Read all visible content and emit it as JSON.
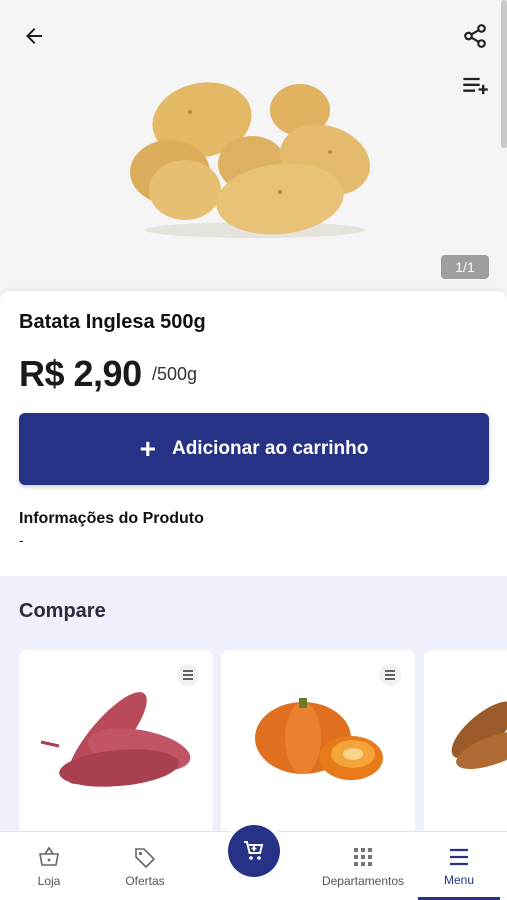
{
  "header": {
    "back_icon": "arrow-left-icon",
    "share_icon": "share-icon",
    "add_to_list_icon": "playlist-add-icon"
  },
  "gallery": {
    "counter": "1/1"
  },
  "product": {
    "name": "Batata Inglesa 500g",
    "price": "R$ 2,90",
    "unit": "/500g",
    "add_to_cart_label": "Adicionar ao carrinho",
    "info_title": "Informações do Produto",
    "info_value": "-"
  },
  "compare": {
    "title": "Compare",
    "items": [
      {
        "image": "sweet-potato"
      },
      {
        "image": "pumpkin"
      },
      {
        "image": "cassava"
      }
    ]
  },
  "bottom_nav": {
    "items": [
      {
        "label": "Loja",
        "icon": "basket-icon"
      },
      {
        "label": "Ofertas",
        "icon": "tag-icon"
      },
      {
        "label": "Departamentos",
        "icon": "grid-icon"
      },
      {
        "label": "Menu",
        "icon": "menu-icon",
        "active": true
      }
    ],
    "cart_icon": "cart-icon"
  },
  "colors": {
    "primary": "#263285",
    "compare_bg": "#eef0fb",
    "hero_bg": "#f5f5f5"
  }
}
